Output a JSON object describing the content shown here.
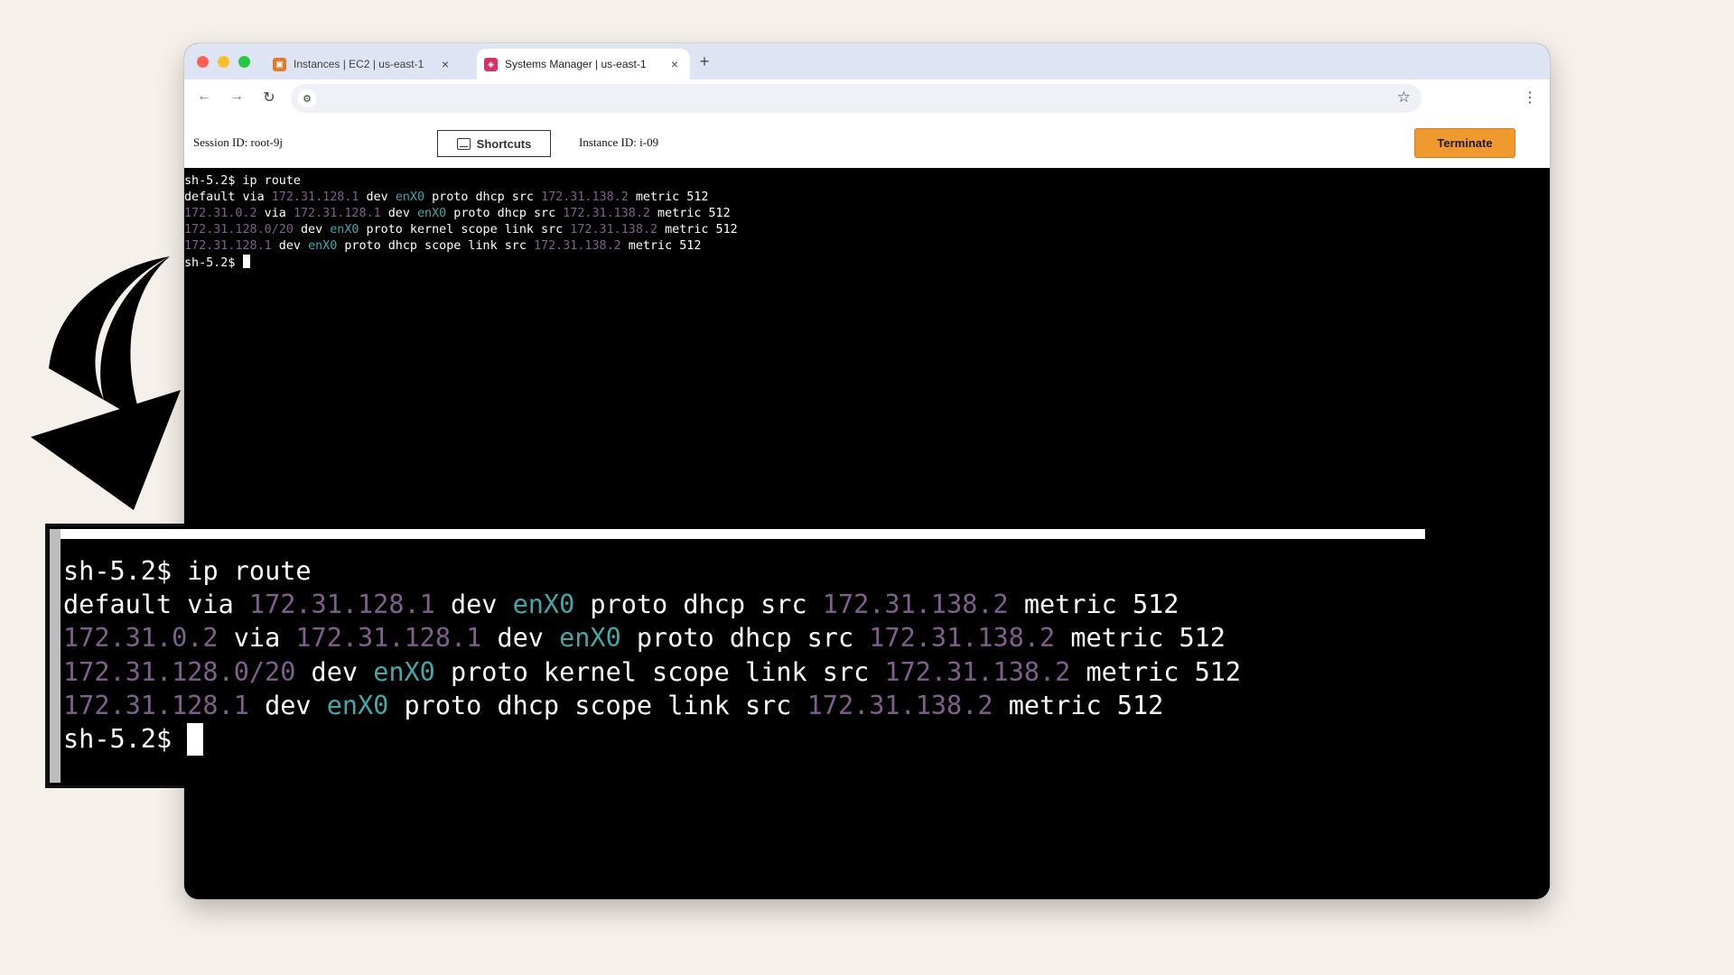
{
  "browser": {
    "tabs": [
      {
        "title": "Instances | EC2 | us-east-1",
        "favicon": "ec2-icon",
        "active": false
      },
      {
        "title": "Systems Manager | us-east-1",
        "favicon": "systems-manager-icon",
        "active": true
      }
    ],
    "new_tab_symbol": "+",
    "close_symbol": "×",
    "url": ""
  },
  "session_bar": {
    "session_id": "Session ID: root-9j",
    "shortcuts_label": "Shortcuts",
    "instance_id": "Instance ID: i-09",
    "terminate_label": "Terminate"
  },
  "terminal": {
    "prompt": "sh-5.2$ ",
    "command": "ip route",
    "colors": {
      "ip": "#7f5f8c",
      "interface": "#41a9a7",
      "text": "#ffffff",
      "background": "#000000",
      "accent": "#f0992e"
    },
    "routes": [
      [
        {
          "t": "default via ",
          "k": "txt"
        },
        {
          "t": "172.31.128.1",
          "k": "ip"
        },
        {
          "t": " dev ",
          "k": "txt"
        },
        {
          "t": "enX0",
          "k": "dev"
        },
        {
          "t": " proto dhcp src ",
          "k": "txt"
        },
        {
          "t": "172.31.138.2",
          "k": "ip"
        },
        {
          "t": " metric 512",
          "k": "txt"
        }
      ],
      [
        {
          "t": "172.31.0.2",
          "k": "ip"
        },
        {
          "t": " via ",
          "k": "txt"
        },
        {
          "t": "172.31.128.1",
          "k": "ip"
        },
        {
          "t": " dev ",
          "k": "txt"
        },
        {
          "t": "enX0",
          "k": "dev"
        },
        {
          "t": " proto dhcp src ",
          "k": "txt"
        },
        {
          "t": "172.31.138.2",
          "k": "ip"
        },
        {
          "t": " metric 512",
          "k": "txt"
        }
      ],
      [
        {
          "t": "172.31.128.0/20",
          "k": "ip"
        },
        {
          "t": " dev ",
          "k": "txt"
        },
        {
          "t": "enX0",
          "k": "dev"
        },
        {
          "t": " proto kernel scope link src ",
          "k": "txt"
        },
        {
          "t": "172.31.138.2",
          "k": "ip"
        },
        {
          "t": " metric 512",
          "k": "txt"
        }
      ],
      [
        {
          "t": "172.31.128.1",
          "k": "ip"
        },
        {
          "t": " dev ",
          "k": "txt"
        },
        {
          "t": "enX0",
          "k": "dev"
        },
        {
          "t": " proto dhcp scope link src ",
          "k": "txt"
        },
        {
          "t": "172.31.138.2",
          "k": "ip"
        },
        {
          "t": " metric 512",
          "k": "txt"
        }
      ]
    ]
  }
}
